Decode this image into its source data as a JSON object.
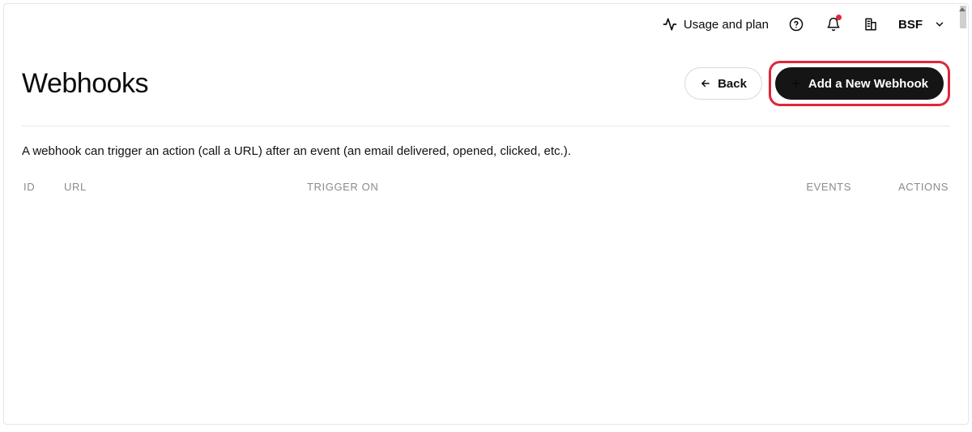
{
  "topbar": {
    "usage_label": "Usage and plan",
    "workspace_label": "BSF"
  },
  "header": {
    "title": "Webhooks",
    "back_label": "Back",
    "add_label": "Add a New Webhook"
  },
  "description": "A webhook can trigger an action (call a URL) after an event (an email delivered, opened, clicked, etc.).",
  "table": {
    "columns": {
      "id": "ID",
      "url": "URL",
      "trigger_on": "TRIGGER ON",
      "events": "EVENTS",
      "actions": "ACTIONS"
    }
  }
}
